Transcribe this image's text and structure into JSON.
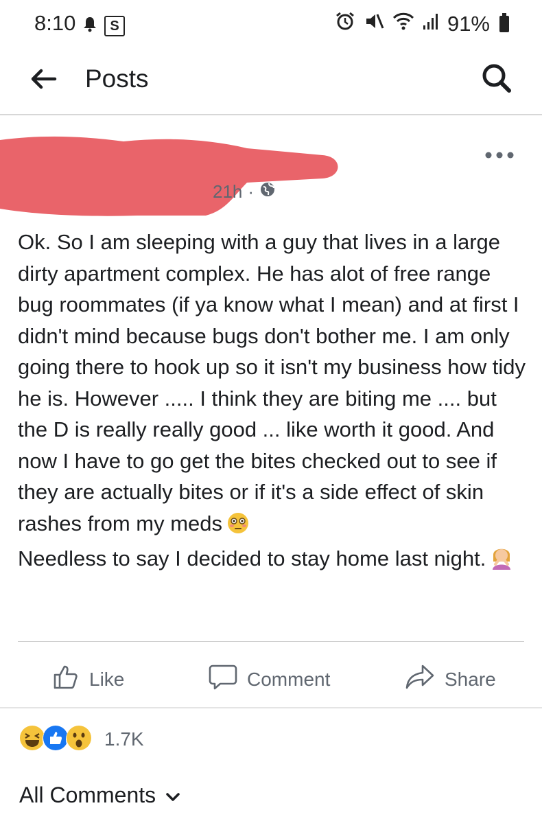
{
  "status_bar": {
    "time": "8:10",
    "s_badge": "S",
    "battery": "91%"
  },
  "app_bar": {
    "title": "Posts"
  },
  "post": {
    "age": "21h",
    "separator": "·",
    "text": "Ok. So I am sleeping with a guy that lives in a large dirty apartment complex. He has alot of free range bug roommates (if ya know what I mean) and at first I didn't mind because bugs don't bother me. I am only going there to hook up so it isn't my business how tidy he is. However ..... I think they are biting me .... but the D is really really good ... like worth it good. And now I have to go get the bites checked out to see if they are actually bites or if it's a side effect of skin rashes from my meds",
    "text_line2": "Needless to say I decided to stay home last night."
  },
  "actions": {
    "like": "Like",
    "comment": "Comment",
    "share": "Share"
  },
  "reactions": {
    "count": "1.7K",
    "icons": [
      "laughing-emoji",
      "like-emoji",
      "wow-emoji"
    ]
  },
  "comments": {
    "label": "All Comments"
  },
  "colors": {
    "redaction": "#e9646a",
    "like_blue": "#1877f2",
    "emoji_yellow": "#f5c33b",
    "secondary_text": "#606770"
  }
}
